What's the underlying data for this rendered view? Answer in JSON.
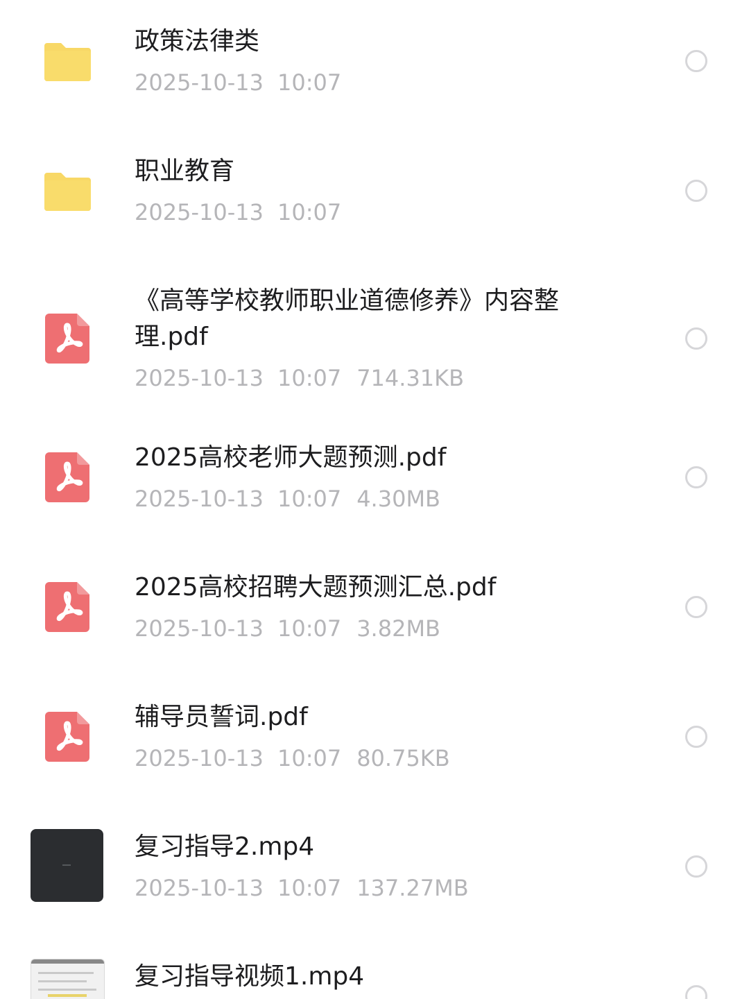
{
  "files": [
    {
      "name": "政策法律类",
      "date": "2025-10-13",
      "time": "10:07",
      "size": "",
      "type": "folder-icon"
    },
    {
      "name": "职业教育",
      "date": "2025-10-13",
      "time": "10:07",
      "size": "",
      "type": "folder-icon"
    },
    {
      "name": "《高等学校教师职业道德修养》内容整\n理.pdf",
      "date": "2025-10-13",
      "time": "10:07",
      "size": "714.31KB",
      "type": "pdf-icon"
    },
    {
      "name": "2025高校老师大题预测.pdf",
      "date": "2025-10-13",
      "time": "10:07",
      "size": "4.30MB",
      "type": "pdf-icon"
    },
    {
      "name": "2025高校招聘大题预测汇总.pdf",
      "date": "2025-10-13",
      "time": "10:07",
      "size": "3.82MB",
      "type": "pdf-icon"
    },
    {
      "name": "辅导员誓词.pdf",
      "date": "2025-10-13",
      "time": "10:07",
      "size": "80.75KB",
      "type": "pdf-icon"
    },
    {
      "name": "复习指导2.mp4",
      "date": "2025-10-13",
      "time": "10:07",
      "size": "137.27MB",
      "type": "video-thumbnail"
    },
    {
      "name": "复习指导视频1.mp4",
      "type": "video-thumbnail"
    }
  ],
  "colors": {
    "folder": "#f8d866",
    "pdf": "#ee6f72",
    "meta_text": "#b5b5b8",
    "name_text": "#1d1d1f"
  }
}
